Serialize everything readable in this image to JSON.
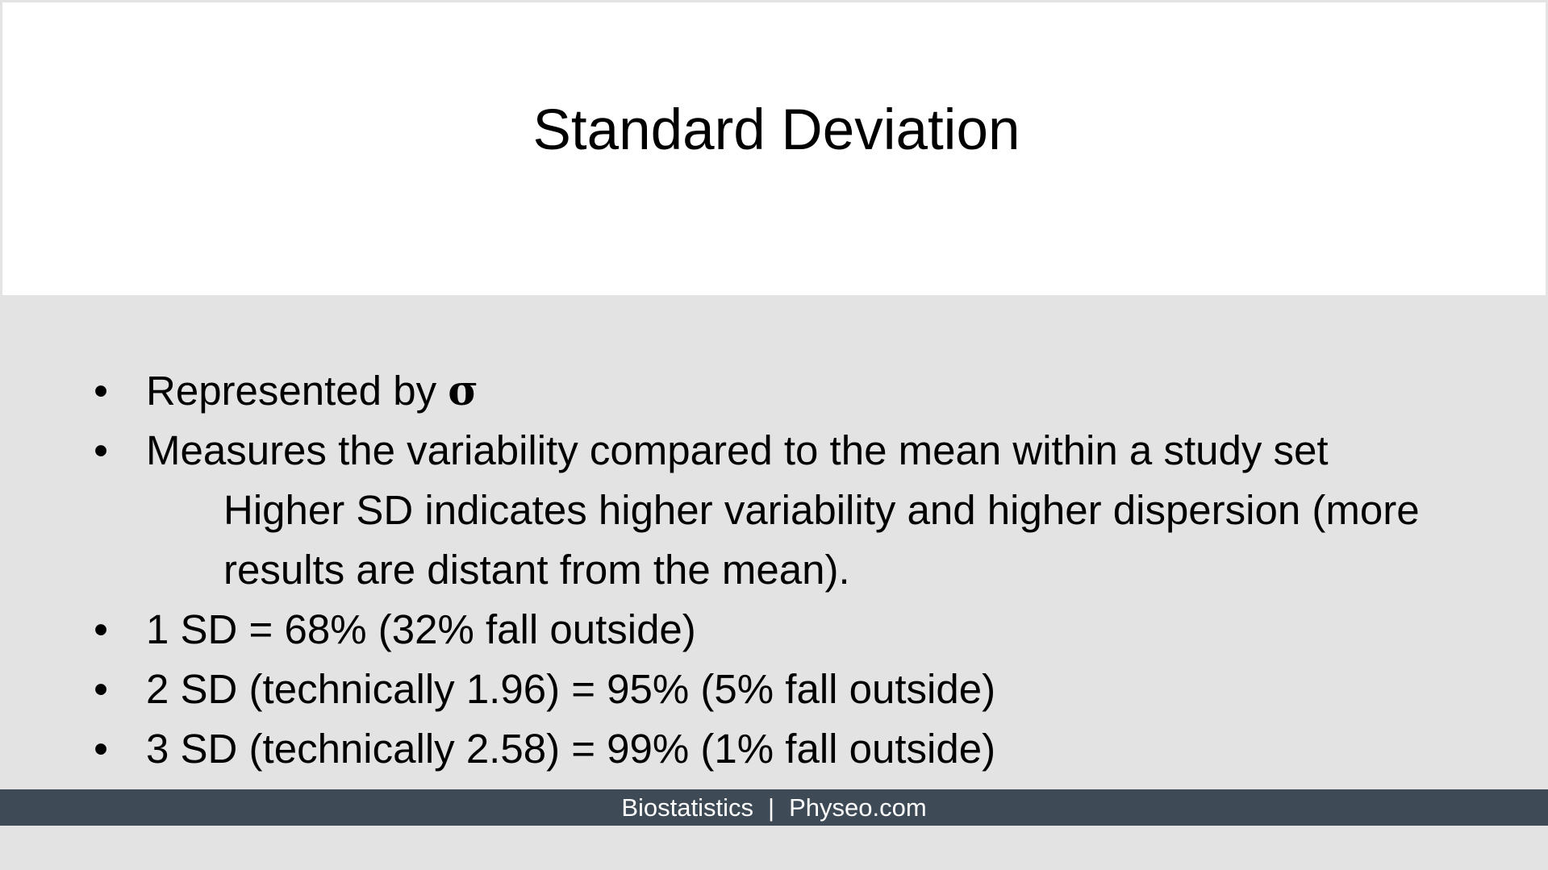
{
  "slide": {
    "title": "Standard Deviation",
    "bullets": [
      {
        "marker": "•",
        "text": "Represented by ",
        "symbol": "σ"
      },
      {
        "marker": "•",
        "text": "Measures the variability compared to the mean within a study set"
      },
      {
        "sub_line_1": "Higher SD indicates higher variability and higher dispersion (more",
        "sub_line_2": "results are distant from the mean)."
      },
      {
        "marker": "•",
        "text": "1 SD = 68% (32% fall outside)"
      },
      {
        "marker": "•",
        "text": "2 SD (technically 1.96) = 95% (5% fall outside)"
      },
      {
        "marker": "•",
        "text": "3 SD (technically 2.58) = 99% (1% fall outside)"
      }
    ]
  },
  "footer": {
    "left": "Biostatistics",
    "separator": "|",
    "right": "Physeo.com"
  },
  "colors": {
    "body_background": "#e3e3e3",
    "title_background": "#ffffff",
    "footer_background": "#3e4a56",
    "footer_text": "#ffffff",
    "text": "#000000"
  }
}
